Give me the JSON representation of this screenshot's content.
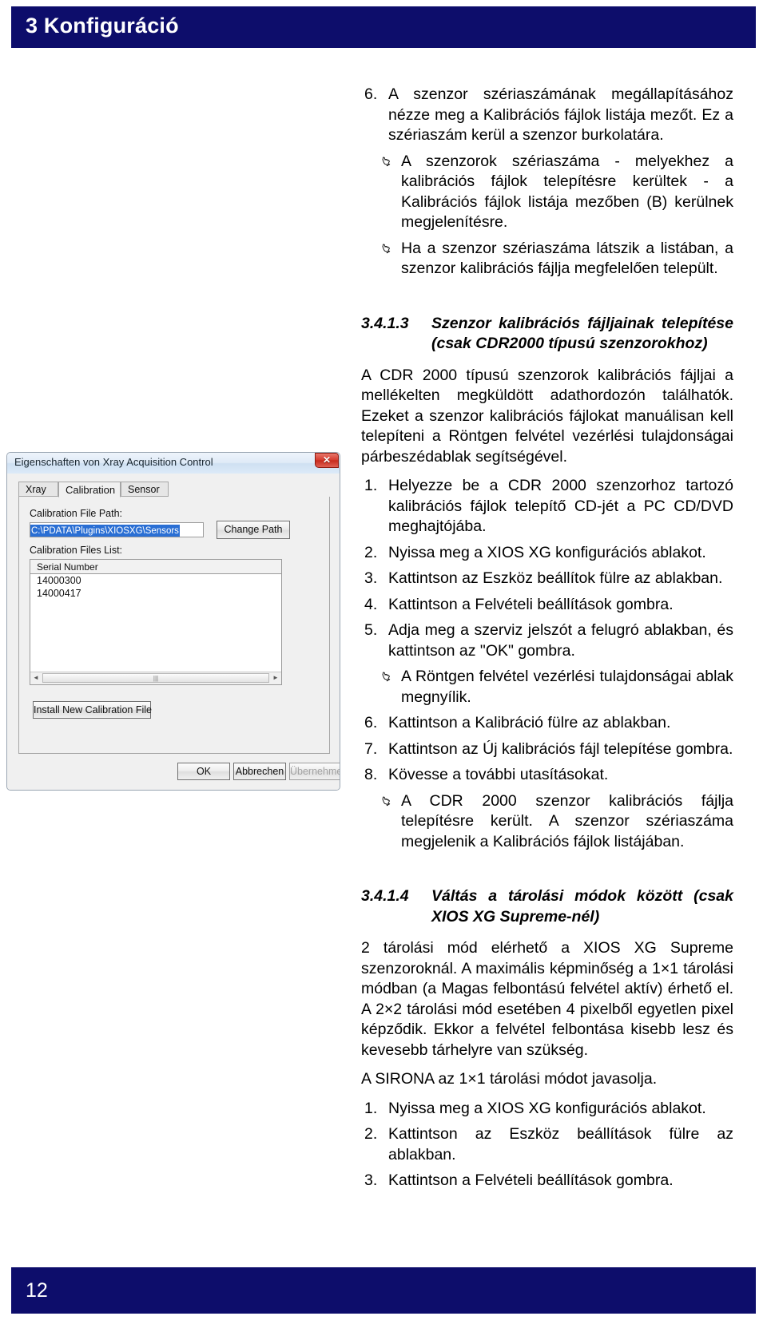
{
  "header": {
    "chapter_title": "3 Konfiguráció",
    "banner_color": "#0d0d6b"
  },
  "footer": {
    "page_number": "12"
  },
  "content": {
    "item6": {
      "marker": "6.",
      "text": "A szenzor szériaszámának megállapításához nézze meg a Kalibrációs fájlok listája mezőt. Ez a szériaszám kerül a szenzor burkolatára."
    },
    "note1": "A szenzorok szériaszáma - melyekhez a kalibrációs fájlok telepítésre kerültek - a Kalibrációs fájlok listája mezőben (B) kerülnek megjelenítésre.",
    "note2": "Ha a szenzor szériaszáma látszik a listában, a szenzor kalibrációs fájlja megfelelően települt.",
    "heading_3413": {
      "number": "3.4.1.3",
      "title": "Szenzor kalibrációs fájljainak telepítése (csak CDR2000 típusú szenzorokhoz)"
    },
    "intro_3413": "A CDR 2000 típusú szenzorok kalibrációs fájljai a mellékelten megküldött adathordozón találhatók. Ezeket a szenzor kalibrációs fájlokat manuálisan kell telepíteni a Röntgen felvétel vezérlési tulajdonságai párbeszédablak segítségével.",
    "steps_3413": [
      {
        "marker": "1.",
        "text": "Helyezze be a CDR 2000 szenzorhoz tartozó kalibrációs fájlok telepítő CD-jét a PC CD/DVD meghajtójába."
      },
      {
        "marker": "2.",
        "text": "Nyissa meg a XIOS XG konfigurációs ablakot."
      },
      {
        "marker": "3.",
        "text": "Kattintson az Eszköz beállítok fülre az ablakban."
      },
      {
        "marker": "4.",
        "text": "Kattintson a Felvételi beállítások gombra."
      },
      {
        "marker": "5.",
        "text": "Adja meg a szerviz jelszót a felugró ablakban, és kattintson az \"OK\" gombra."
      }
    ],
    "note3": "A Röntgen felvétel vezérlési tulajdonságai ablak megnyílik.",
    "steps_3413_cont": [
      {
        "marker": "6.",
        "text": "Kattintson a Kalibráció fülre az ablakban."
      },
      {
        "marker": "7.",
        "text": "Kattintson az Új kalibrációs fájl telepítése gombra."
      },
      {
        "marker": "8.",
        "text": "Kövesse a további utasításokat."
      }
    ],
    "note4": "A CDR 2000 szenzor kalibrációs fájlja telepítésre került. A szenzor szériaszáma megjelenik a Kalibrációs fájlok listájában.",
    "heading_3414": {
      "number": "3.4.1.4",
      "title": "Váltás a tárolási módok között (csak XIOS XG Supreme-nél)"
    },
    "body_3414": "2 tárolási mód elérhető a XIOS XG Supreme szenzoroknál. A maximális képminőség a 1×1 tárolási módban (a Magas felbontású felvétel aktív) érhető el. A 2×2 tárolási mód esetében 4 pixelből egyetlen pixel képződik. Ekkor a felvétel felbontása kisebb lesz és kevesebb tárhelyre van szükség.",
    "recommend_3414": "A SIRONA az 1×1 tárolási módot javasolja.",
    "steps_3414": [
      {
        "marker": "1.",
        "text": "Nyissa meg a XIOS XG konfigurációs ablakot."
      },
      {
        "marker": "2.",
        "text": "Kattintson az Eszköz beállítások fülre az ablakban."
      },
      {
        "marker": "3.",
        "text": "Kattintson a Felvételi beállítások gombra."
      }
    ]
  },
  "dialog": {
    "title": "Eigenschaften von Xray Acquisition Control",
    "close_label": "✕",
    "tabs": [
      {
        "label": "Xray"
      },
      {
        "label": "Calibration"
      },
      {
        "label": "Sensor"
      }
    ],
    "path_label": "Calibration File Path:",
    "path_value": "C:\\PDATA\\Plugins\\XIOSXG\\Sensors",
    "change_path_button": "Change Path",
    "list_label": "Calibration Files List:",
    "list_column": "Serial Number",
    "list_rows": [
      "14000300",
      "14000417"
    ],
    "install_button": "Install New Calibration File",
    "scroll_left": "◄",
    "scroll_right": "►",
    "scroll_grip": "|||",
    "buttons": {
      "ok": "OK",
      "cancel": "Abbrechen",
      "apply": "Übernehmen"
    }
  }
}
